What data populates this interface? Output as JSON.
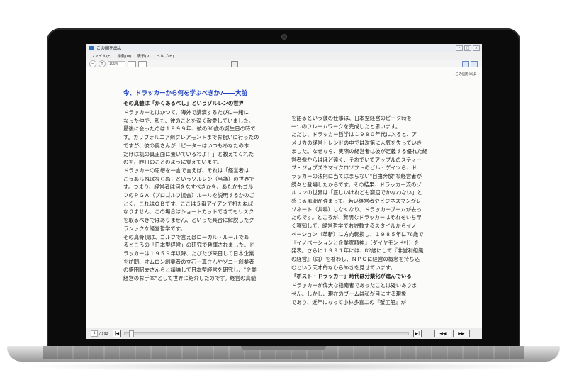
{
  "window": {
    "title": "この国を出よ"
  },
  "menu": [
    "ファイル(F)",
    "移動(M)",
    "表示(V)",
    "ヘルプ(H)"
  ],
  "toolbar": {
    "zoom": "100%"
  },
  "page": {
    "running_head": "この国を出よ",
    "left_column": [
      {
        "type": "link",
        "text": "今、ドラッカーから何を学ぶべきか?――大前"
      },
      {
        "type": "head",
        "text": "その真髄は「かくあるべし」というゾルレンの世界"
      },
      {
        "type": "text",
        "text": "ドラッカーとはかつて、海外で講演するたびに一緒に"
      },
      {
        "type": "text",
        "text": "なった仲で、私も、彼のことを深く敬愛していました。"
      },
      {
        "type": "text",
        "text": "最後に会ったのは１９９９年、彼の90歳の誕生日の時で"
      },
      {
        "type": "text",
        "text": "す。カリフォルニア州クレアモントまでお祝いに行ったの"
      },
      {
        "type": "text",
        "text": "ですが、彼の奥さんが「ピーターはいつもあなたの本"
      },
      {
        "type": "text",
        "text": "だけは机の真正面に置いているわよ！」と教えてくれた"
      },
      {
        "type": "text",
        "text": "のを、昨日のことのように覚えています。"
      },
      {
        "type": "text",
        "text": "ドラッカーの思想を一言で言えば、それは「経営者は"
      },
      {
        "type": "text",
        "text": "こうあらねばならぬ」というゾルレン（当為）の世界で"
      },
      {
        "type": "text",
        "text": "す。つまり、経営者は何をなすべきかを、あたかもゴル"
      },
      {
        "type": "text",
        "text": "フのＰＧＡ（プロゴルフ協会）ルールを説明するかのご"
      },
      {
        "type": "text",
        "text": "とく、これはＯＢです、ここは５番アイアンで打たねば"
      },
      {
        "type": "text",
        "text": "なりません、この場合はショートカットできてもリスク"
      },
      {
        "type": "text",
        "text": "を取るべきではありません、といった具合に解説したク"
      },
      {
        "type": "text",
        "text": "ラシックな経営哲学です。"
      },
      {
        "type": "text",
        "text": "その真骨頂は、ゴルフで言えばローカル・ルールであ"
      },
      {
        "type": "text",
        "text": "るところの「日本型経営」の研究で発揮されました。ド"
      },
      {
        "type": "text",
        "text": "ラッカーは１９５９年以降、たびたび来日して日本企業"
      },
      {
        "type": "text",
        "text": "を訪問、オムロン創業者の立石一真さんやソニー創業者"
      },
      {
        "type": "text",
        "text": "の盛田昭夫さんらと議論して日本型経営を研究し、\"企業"
      },
      {
        "type": "text",
        "text": "経営のお手本\"として世界に紹介したのです。経営の真髄"
      }
    ],
    "right_column": [
      {
        "type": "text",
        "text": "を語るという彼の仕事は、日本型経営のピーク時を"
      },
      {
        "type": "text",
        "text": "一つのフレームワークを完成したと思います。"
      },
      {
        "type": "text",
        "text": "ただし、ドラッカー哲学は１９８０年代に入ると、ア"
      },
      {
        "type": "text",
        "text": "メリカの経営トレンドの中では次第に人気を失っていき"
      },
      {
        "type": "text",
        "text": "ました。なぜなら、実際の経営者は彼が定義する優れた経"
      },
      {
        "type": "text",
        "text": "営者像からはほど遠く、それでいてアップルのスティー"
      },
      {
        "type": "text",
        "text": "ブ・ジョブズやマイクロソフトのビル・ゲイツら、ド"
      },
      {
        "type": "text",
        "text": "ラッカーの法則に当てはまらない\"自由奔放\"な経営者が"
      },
      {
        "type": "text",
        "text": "続々と登場したからです。その結果、ドラッカー流のゾ"
      },
      {
        "type": "text",
        "text": "ルレンの世界は「正しいけれども窮屈でかなわない」と"
      },
      {
        "type": "text",
        "text": "感じる風潮が強まって、若い経営者やビジネスマンがレ"
      },
      {
        "type": "text",
        "text": "ゾネート（共鳴）しなくなり、ドラッカーブームが去っ"
      },
      {
        "type": "text",
        "text": "たのです。ところが、賢明なドラッカーはそれをいち早"
      },
      {
        "type": "text",
        "text": "く察知して、経営哲学でお説教するスタイルからイノ"
      },
      {
        "type": "text",
        "text": "ベーション（革新）に方向転換し、１９８５年に76歳で"
      },
      {
        "type": "text",
        "text": "『イノベーションと企業家精神』（ダイヤモンド社）を"
      },
      {
        "type": "text",
        "text": "発表。さらに１９９１年には、82歳にして『非営利組織"
      },
      {
        "type": "text",
        "text": "の経営』（同）を著わし、ＮＰＯに経営の概念を持ち込"
      },
      {
        "type": "text",
        "text": "むという天才的なひらめきを見せています。"
      },
      {
        "type": "head",
        "text": "「ポスト・ドラッカー」時代は分業化が進んでいる"
      },
      {
        "type": "text",
        "text": "ドラッカーが偉大な指南者であったことは疑いありま"
      },
      {
        "type": "text",
        "text": "せん。しかし、現在のブームは私が目にする現象"
      },
      {
        "type": "text",
        "text": "であり、近年になって小林多喜二の『蟹工船』が"
      }
    ]
  },
  "status": {
    "page_current": "4",
    "page_total": "/ 192"
  }
}
